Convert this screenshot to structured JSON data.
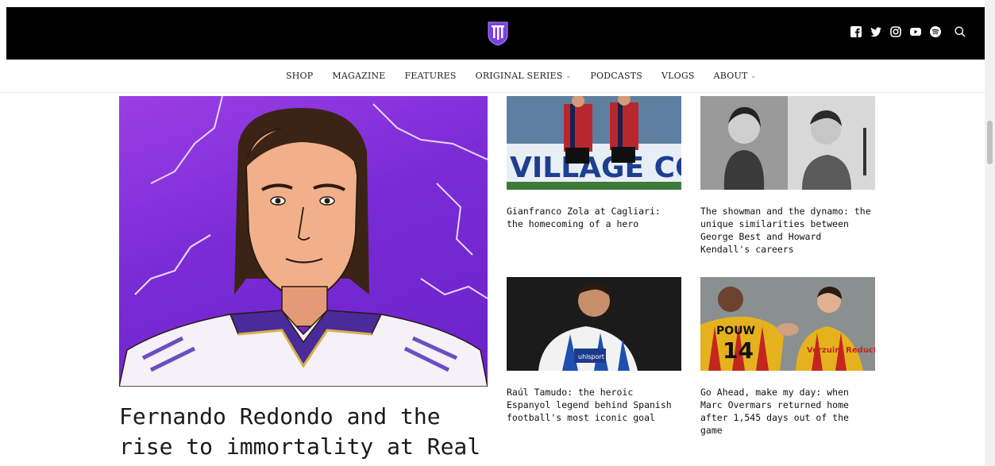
{
  "nav": {
    "items": [
      {
        "label": "SHOP",
        "dropdown": false
      },
      {
        "label": "MAGAZINE",
        "dropdown": false
      },
      {
        "label": "FEATURES",
        "dropdown": false
      },
      {
        "label": "ORIGINAL SERIES",
        "dropdown": true
      },
      {
        "label": "PODCASTS",
        "dropdown": false
      },
      {
        "label": "VLOGS",
        "dropdown": false
      },
      {
        "label": "ABOUT",
        "dropdown": true
      }
    ]
  },
  "header": {
    "social_icons": [
      "facebook-icon",
      "twitter-icon",
      "instagram-icon",
      "youtube-icon",
      "spotify-icon"
    ],
    "accent": "#7b3fe4"
  },
  "hero": {
    "title": "Fernando Redondo and the rise to immortality at Real"
  },
  "cards": [
    {
      "caption": "Gianfranco Zola at Cagliari: the homecoming of a hero",
      "banner_text": "VILLAGE COM"
    },
    {
      "caption": "The showman and the dynamo: the unique similarities between George Best and Howard Kendall's careers"
    },
    {
      "caption": "Raúl Tamudo: the heroic Espanyol legend behind Spanish football's most iconic goal",
      "shirt_text": "uhlsport"
    },
    {
      "caption": "Go Ahead, make my day: when Marc Overmars returned home after 1,545 days out of the game",
      "shirt_number": "14",
      "shirt_text_left": "POUW",
      "shirt_text_right": "Verzuim Reductie"
    }
  ]
}
